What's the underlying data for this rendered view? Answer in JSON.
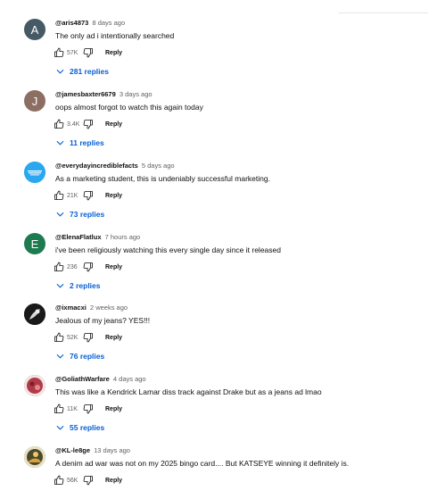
{
  "comments": [
    {
      "author": "@aris4873",
      "time": "8 days ago",
      "text": "The only ad i intentionally searched",
      "likes": "57K",
      "reply_label": "Reply",
      "replies_label": "281 replies",
      "avatar_letter": "A",
      "avatar_color": "#455a64"
    },
    {
      "author": "@jamesbaxter6679",
      "time": "3 days ago",
      "text": "oops almost forgot to watch this again today",
      "likes": "3.4K",
      "reply_label": "Reply",
      "replies_label": "11 replies",
      "avatar_letter": "J",
      "avatar_color": "#8d6e63"
    },
    {
      "author": "@everydayincrediblefacts",
      "time": "5 days ago",
      "text": "As a marketing student, this is undeniably successful marketing.",
      "likes": "21K",
      "reply_label": "Reply",
      "replies_label": "73 replies",
      "avatar_letter": "",
      "avatar_color": "#29a8f0"
    },
    {
      "author": "@ElenaFlatlux",
      "time": "7 hours ago",
      "text": "i've been religiously watching this every single day since it released",
      "likes": "236",
      "reply_label": "Reply",
      "replies_label": "2 replies",
      "avatar_letter": "E",
      "avatar_color": "#1e7a4f"
    },
    {
      "author": "@ixmacxi",
      "time": "2 weeks ago",
      "text": "Jealous of my jeans? YES!!!",
      "likes": "52K",
      "reply_label": "Reply",
      "replies_label": "76 replies",
      "avatar_letter": "",
      "avatar_color": "#222222"
    },
    {
      "author": "@GoliathWarfare",
      "time": "4 days ago",
      "text": "This was like a Kendrick Lamar diss track against Drake but as a jeans ad lmao",
      "likes": "11K",
      "reply_label": "Reply",
      "replies_label": "55 replies",
      "avatar_letter": "",
      "avatar_color": "#b23a48"
    },
    {
      "author": "@KL-le8ge",
      "time": "13 days ago",
      "text": "A denim ad war was not on my 2025 bingo card.... But KATSEYE winning it definitely is.",
      "likes": "56K",
      "reply_label": "Reply",
      "replies_label": "",
      "avatar_letter": "",
      "avatar_color": "#7a6a3a"
    }
  ],
  "colors": {
    "link": "#065fd4",
    "muted": "#606060"
  }
}
